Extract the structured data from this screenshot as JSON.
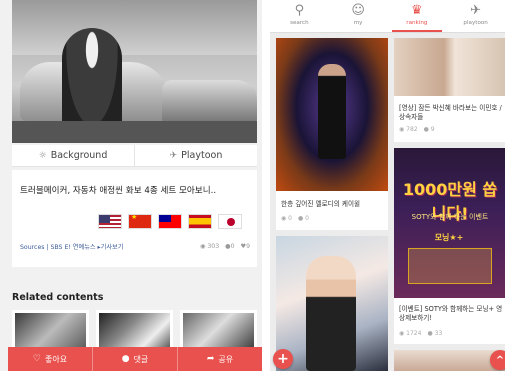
{
  "left": {
    "tabs": [
      {
        "icon": "sun-icon",
        "label": "Background"
      },
      {
        "icon": "dancer-icon",
        "label": "Playtoon"
      }
    ],
    "article": {
      "title": "트러블메이커, 자동차 애정씬 화보 4종 세트 모아보니..",
      "flags": [
        "us-flag",
        "china-flag",
        "taiwan-flag",
        "spain-flag",
        "japan-flag"
      ],
      "source": "Sources | SBS E! 연예뉴스 ▸기사보기",
      "views": "303",
      "comments": "0",
      "likes": "9"
    },
    "related_title": "Related contents",
    "actions": [
      {
        "icon": "heart-icon",
        "label": "좋아요"
      },
      {
        "icon": "comment-icon",
        "label": "댓글"
      },
      {
        "icon": "share-icon",
        "label": "공유"
      }
    ]
  },
  "right": {
    "nav": [
      {
        "icon": "search-icon",
        "label": "search",
        "active": false
      },
      {
        "icon": "user-icon",
        "label": "my",
        "active": false
      },
      {
        "icon": "crown-icon",
        "label": "ranking",
        "active": true
      },
      {
        "icon": "dancer-icon",
        "label": "playtoon",
        "active": false
      }
    ],
    "cards": [
      {
        "caption": "한층 깊어진 멜로디의 케이윌",
        "views": "0",
        "comments": "0"
      },
      {
        "caption": "[영상] 잠든 박신혜 바라보는 이민호 / 상속자들",
        "views": "782",
        "comments": "9"
      },
      {
        "promo_big": "1000만원 쏩니다!",
        "promo_small": "SOTY와 함께 하는 이벤트",
        "promo_logo": "모닝★+",
        "caption": "[이벤트] SOTY와 함께하는 모닝+ 영상제보하기!",
        "views": "1724",
        "comments": "33"
      }
    ],
    "fab_add": "+",
    "fab_top": "^"
  },
  "colors": {
    "accent": "#e8514d",
    "link": "#3a5a9a"
  }
}
